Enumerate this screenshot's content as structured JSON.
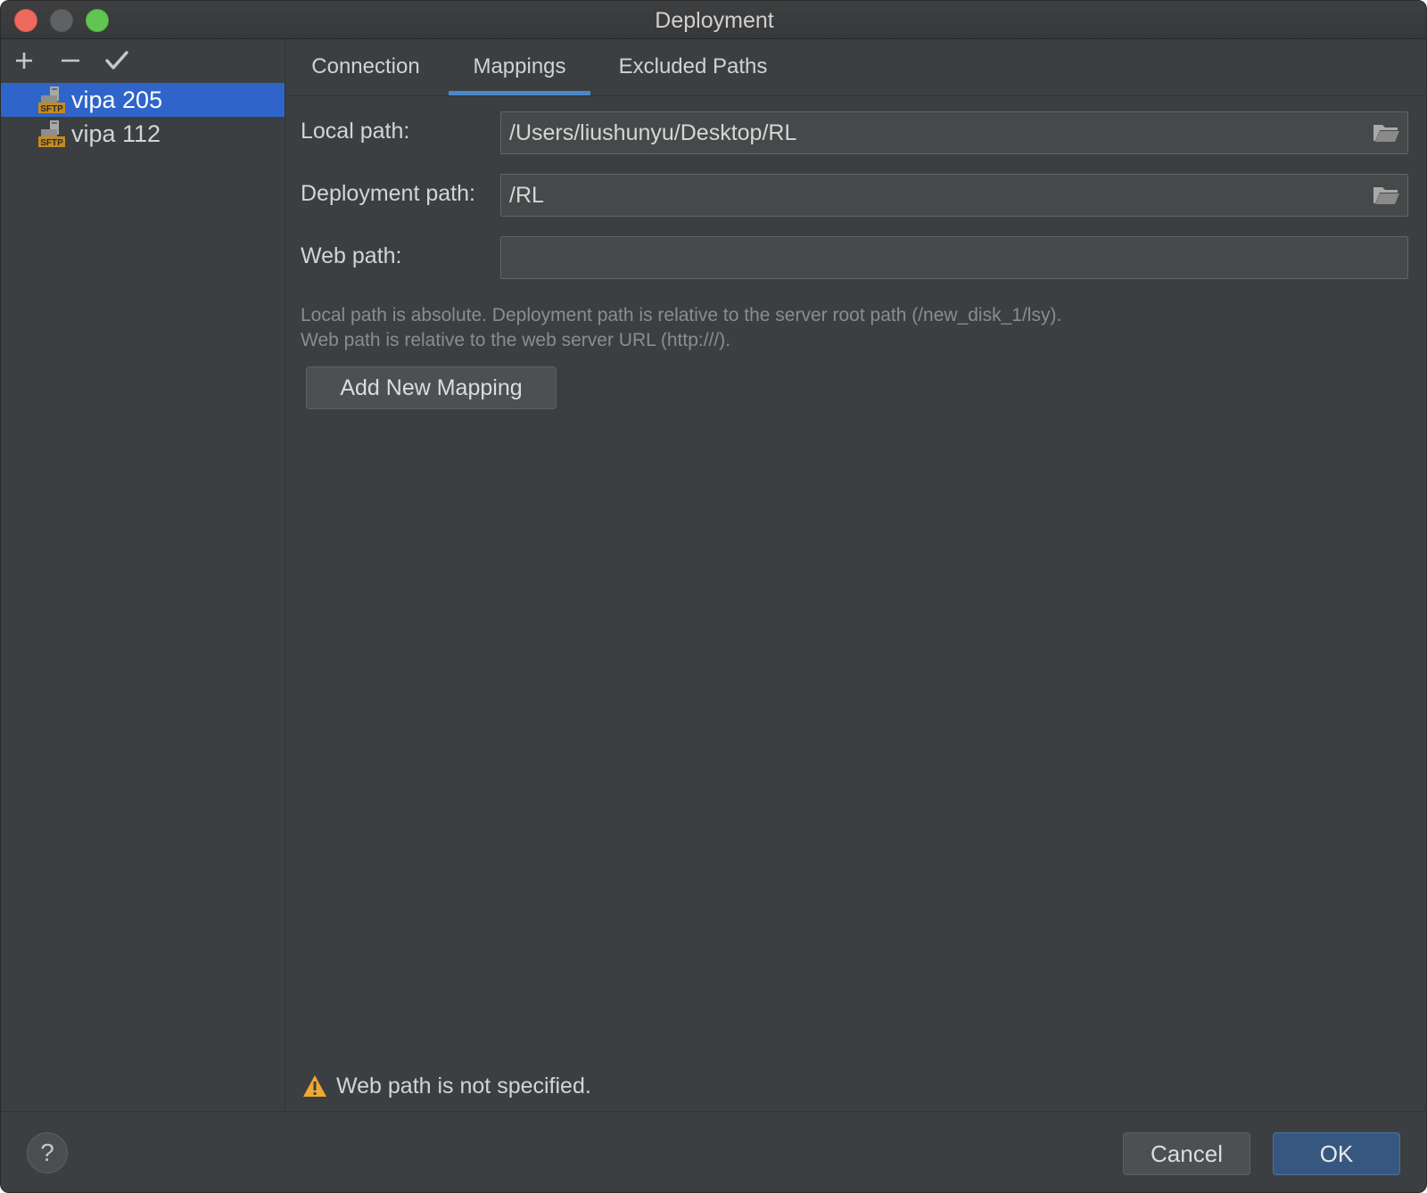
{
  "window": {
    "title": "Deployment"
  },
  "sidebar": {
    "toolbar": {
      "add_label": "+",
      "remove_label": "−",
      "apply_icon": "checkmark-icon"
    },
    "servers": [
      {
        "label": "vipa 205",
        "icon": "sftp-server-icon",
        "selected": true
      },
      {
        "label": "vipa 112",
        "icon": "sftp-server-icon",
        "selected": false
      }
    ],
    "sftp_badge": "SFTP"
  },
  "tabs": [
    {
      "label": "Connection",
      "active": false
    },
    {
      "label": "Mappings",
      "active": true
    },
    {
      "label": "Excluded Paths",
      "active": false
    }
  ],
  "mappings": {
    "local_path": {
      "label": "Local path:",
      "value": "/Users/liushunyu/Desktop/RL"
    },
    "deployment_path": {
      "label": "Deployment path:",
      "value": "/RL"
    },
    "web_path": {
      "label": "Web path:",
      "value": ""
    },
    "hint_line1": "Local path is absolute. Deployment path is relative to the server root path (/new_disk_1/lsy).",
    "hint_line2": "Web path is relative to the web server URL (http:///).",
    "add_button": "Add New Mapping",
    "warning": "Web path is not specified."
  },
  "footer": {
    "help_label": "?",
    "cancel_label": "Cancel",
    "ok_label": "OK"
  },
  "colors": {
    "background": "#3c3f41",
    "selection": "#2f65ca",
    "tab_underline": "#4a88c7",
    "ok_button": "#365880",
    "warning": "#f0a732"
  }
}
